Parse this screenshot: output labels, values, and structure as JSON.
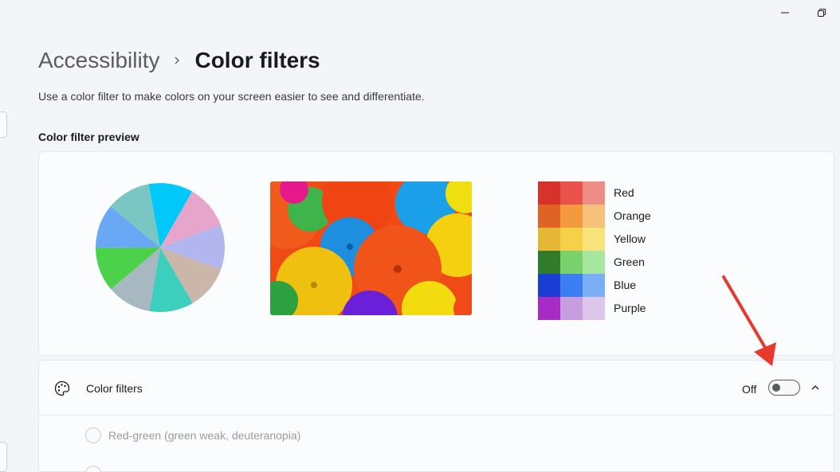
{
  "window": {
    "controls": [
      {
        "name": "minimize",
        "icon": "minimize-icon"
      },
      {
        "name": "restore",
        "icon": "restore-icon"
      }
    ]
  },
  "breadcrumb": {
    "parent": "Accessibility",
    "separator_icon": "chevron-right-icon",
    "current": "Color filters"
  },
  "description": "Use a color filter to make colors on your screen easier to see and differentiate.",
  "preview": {
    "title": "Color filter preview",
    "pie_colors": [
      "#00c8f8",
      "#e6a6cb",
      "#b2b6ef",
      "#cbb6aa",
      "#3ccfbe",
      "#a8b8c0",
      "#4cd24a",
      "#6aa7f5",
      "#79c6c2"
    ],
    "color_rows": [
      {
        "label": "Red",
        "swatches": [
          "#d8322c",
          "#e8524a",
          "#ee8d86"
        ]
      },
      {
        "label": "Orange",
        "swatches": [
          "#e06326",
          "#f29a3c",
          "#f6c27a"
        ]
      },
      {
        "label": "Yellow",
        "swatches": [
          "#e8b635",
          "#f6d148",
          "#f8e47a"
        ]
      },
      {
        "label": "Green",
        "swatches": [
          "#327a2c",
          "#78d36c",
          "#a6e6a0"
        ]
      },
      {
        "label": "Blue",
        "swatches": [
          "#1a3ed4",
          "#3b7ef2",
          "#7aaef6"
        ]
      },
      {
        "label": "Purple",
        "swatches": [
          "#a92bc6",
          "#c69ee0",
          "#dcc6ea"
        ]
      }
    ]
  },
  "color_filters": {
    "label": "Color filters",
    "icon": "palette-icon",
    "toggle_state": "Off",
    "toggle_on": false,
    "expand_icon": "chevron-up-icon",
    "options": [
      {
        "label": "Red-green (green weak, deuteranopia)"
      }
    ]
  },
  "annotation": {
    "color": "#e8392d"
  }
}
